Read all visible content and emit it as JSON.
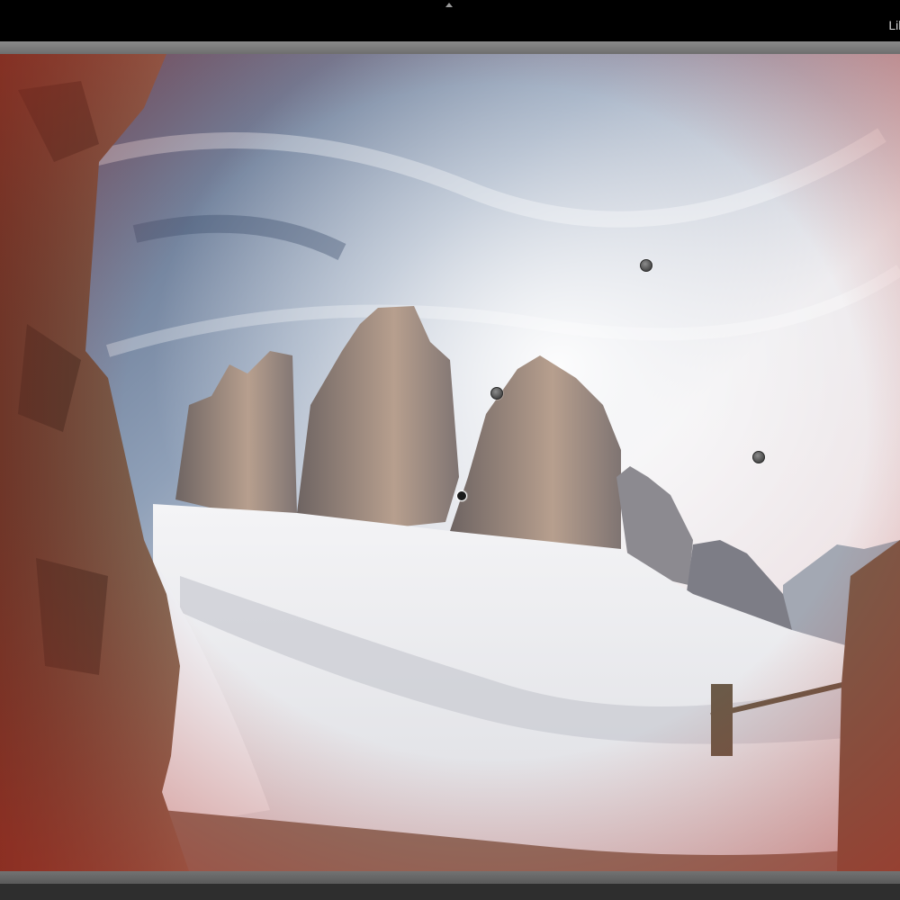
{
  "top_bar": {
    "module_label": "Lib"
  },
  "photo": {
    "subject": "mountain-landscape-photo",
    "tint_color": "#b3261b"
  },
  "pins": [
    {
      "id": "pin-1",
      "state": "inactive"
    },
    {
      "id": "pin-2",
      "state": "inactive"
    },
    {
      "id": "pin-3",
      "state": "inactive"
    },
    {
      "id": "pin-4",
      "state": "active"
    }
  ]
}
